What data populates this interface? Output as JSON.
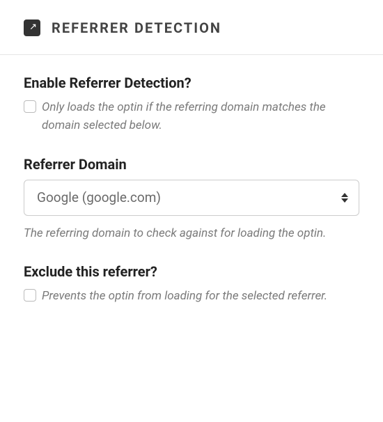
{
  "header": {
    "title": "REFERRER DETECTION"
  },
  "sections": {
    "enable": {
      "title": "Enable Referrer Detection?",
      "desc": "Only loads the optin if the referring domain matches the domain selected below."
    },
    "domain": {
      "title": "Referrer Domain",
      "selected": "Google (google.com)",
      "helper": "The referring domain to check against for loading the optin."
    },
    "exclude": {
      "title": "Exclude this referrer?",
      "desc": "Prevents the optin from loading for the selected referrer."
    }
  }
}
